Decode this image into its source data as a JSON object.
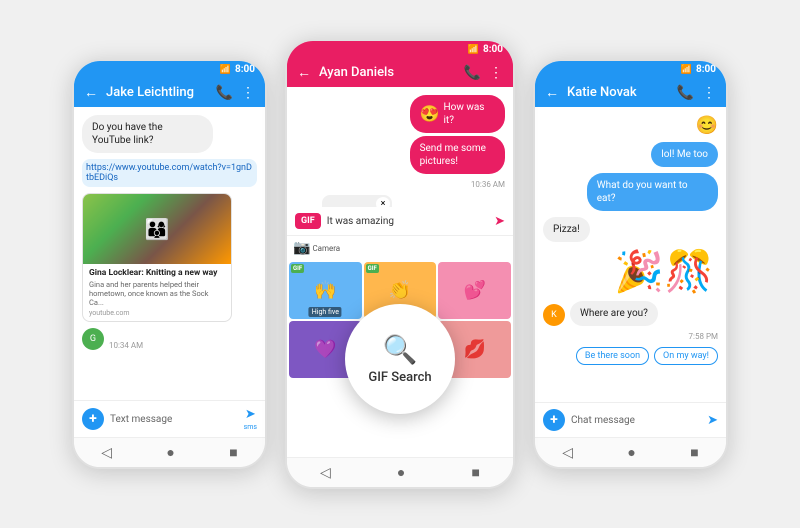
{
  "phones": [
    {
      "id": "phone1",
      "contact": "Jake Leichtling",
      "status_time": "8:00",
      "header_color": "blue",
      "messages": [
        {
          "type": "received",
          "text": "Do you have the YouTube link?"
        },
        {
          "type": "sent",
          "text": "https://www.youtube.com/watch?v=1gnDtbEDiQs",
          "is_link": true
        },
        {
          "type": "preview",
          "title": "Gina Locklear: Knitting a new way",
          "desc": "Gina and her parents helped their hometown, once known as the Sock Ca...",
          "url": "youtube.com"
        },
        {
          "type": "timestamp",
          "text": "10:34 AM"
        }
      ],
      "input_placeholder": "Text message",
      "input_type": "sms"
    },
    {
      "id": "phone2",
      "contact": "Ayan Daniels",
      "status_time": "8:00",
      "header_color": "pink",
      "messages": [
        {
          "type": "sent_pink",
          "text": "How was it?"
        },
        {
          "type": "sent_pink",
          "text": "Send me some pictures!"
        },
        {
          "type": "timestamp",
          "text": "10:36 AM"
        },
        {
          "type": "received_photo"
        },
        {
          "type": "composing",
          "text": "It was amazing"
        }
      ],
      "gif_search_label": "GIF Search",
      "gif_grid": [
        {
          "label": "High five",
          "bg": "blue-bg"
        },
        {
          "label": "Clapping",
          "bg": "orange-bg"
        },
        {
          "label": "",
          "bg": "pink-bg"
        },
        {
          "label": "",
          "bg": "purple-bg"
        },
        {
          "label": "",
          "bg": "teal-bg"
        },
        {
          "label": "",
          "bg": "red-bg"
        }
      ],
      "input_placeholder": "It was amazing"
    },
    {
      "id": "phone3",
      "contact": "Katie Novak",
      "status_time": "8:00",
      "header_color": "blue",
      "messages": [
        {
          "type": "emoji_sticker",
          "text": "😊"
        },
        {
          "type": "sent",
          "text": "lol! Me too"
        },
        {
          "type": "sent",
          "text": "What do you want to eat?"
        },
        {
          "type": "received_text",
          "text": "Pizza!"
        },
        {
          "type": "sticker_pizza"
        },
        {
          "type": "avatar_received",
          "text": "Where are you?"
        },
        {
          "type": "timestamp",
          "text": "7:58 PM"
        },
        {
          "type": "chips",
          "options": [
            "Be there soon",
            "On my way!"
          ]
        }
      ],
      "input_placeholder": "Chat message"
    }
  ]
}
